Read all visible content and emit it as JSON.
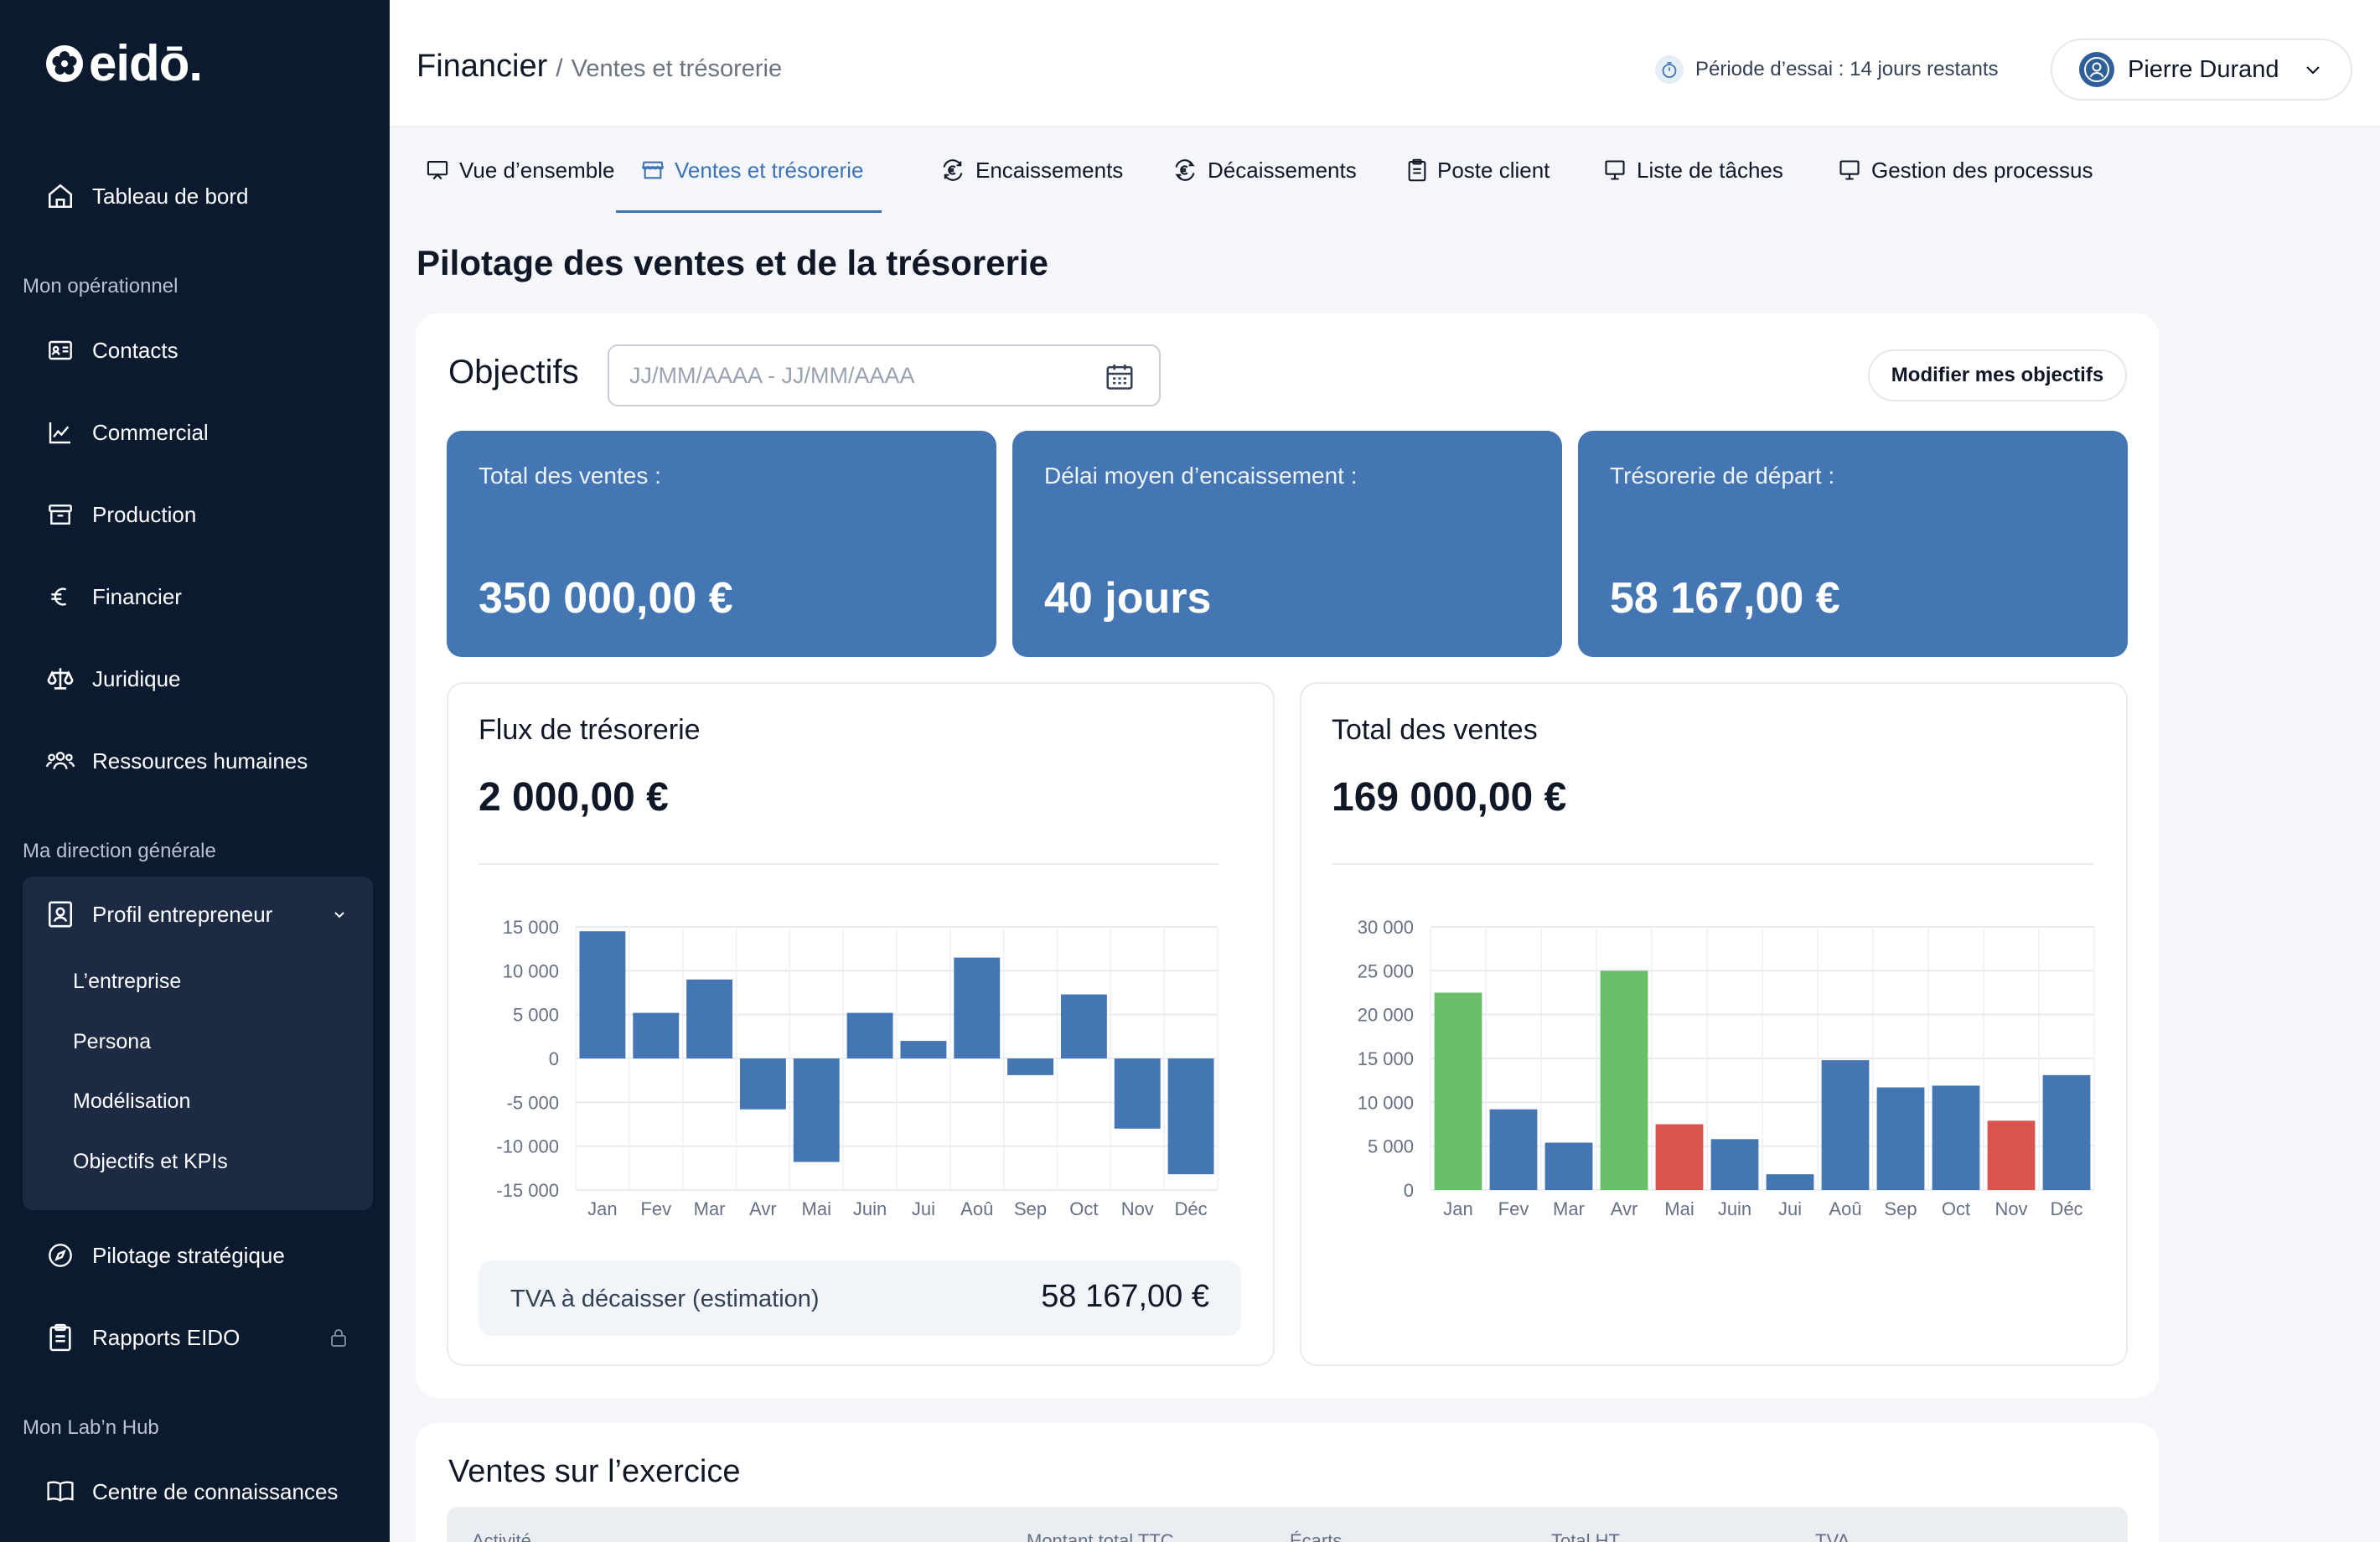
{
  "brand": {
    "name": "eidō."
  },
  "sidebar": {
    "home": {
      "label": "Tableau de bord",
      "icon": "home-icon"
    },
    "sections": [
      {
        "label": "Mon opérationnel"
      },
      {
        "label": "Ma direction générale"
      },
      {
        "label": "Mon Lab’n Hub"
      }
    ],
    "operational": [
      {
        "label": "Contacts",
        "icon": "contact-card-icon"
      },
      {
        "label": "Commercial",
        "icon": "line-chart-icon"
      },
      {
        "label": "Production",
        "icon": "archive-box-icon"
      },
      {
        "label": "Financier",
        "icon": "euro-icon"
      },
      {
        "label": "Juridique",
        "icon": "scale-icon"
      },
      {
        "label": "Ressources humaines",
        "icon": "users-icon"
      }
    ],
    "direction": {
      "label": "Profil entrepreneur",
      "icon": "profile-badge-icon",
      "children": [
        "L’entreprise",
        "Persona",
        "Modélisation",
        "Objectifs et KPIs"
      ]
    },
    "pilotage": {
      "label": "Pilotage stratégique",
      "icon": "compass-icon"
    },
    "rapports": {
      "label": "Rapports EIDO",
      "icon": "clipboard-icon",
      "locked": true
    },
    "hub": {
      "label": "Centre de connaissances",
      "icon": "book-icon"
    }
  },
  "header": {
    "title": "Financier",
    "separator": "/",
    "subtitle": "Ventes et trésorerie",
    "trial": "Période d’essai : 14 jours restants",
    "user": "Pierre Durand"
  },
  "tabs": [
    {
      "label": "Vue d’ensemble",
      "icon": "presentation-icon",
      "active": false
    },
    {
      "label": "Ventes et trésorerie",
      "icon": "store-icon",
      "active": true
    },
    {
      "label": "Encaissements",
      "icon": "euro-in-icon",
      "active": false
    },
    {
      "label": "Décaissements",
      "icon": "euro-out-icon",
      "active": false
    },
    {
      "label": "Poste client",
      "icon": "clipboard-icon",
      "active": false
    },
    {
      "label": "Liste de tâches",
      "icon": "board-icon",
      "active": false
    },
    {
      "label": "Gestion des processus",
      "icon": "board-icon",
      "active": false
    }
  ],
  "page": {
    "title": "Pilotage des ventes et de la trésorerie"
  },
  "objectives": {
    "title": "Objectifs",
    "date_placeholder": "JJ/MM/AAAA - JJ/MM/AAAA",
    "edit_button": "Modifier mes objectifs",
    "kpis": [
      {
        "label": "Total des ventes :",
        "value": "350 000,00 €"
      },
      {
        "label": "Délai moyen d’encaissement :",
        "value": "40 jours"
      },
      {
        "label": "Trésorerie de départ :",
        "value": "58 167,00 €"
      }
    ]
  },
  "cashflow": {
    "title": "Flux de trésorerie",
    "amount": "2 000,00 €",
    "tva_label": "TVA à décaisser (estimation)",
    "tva_value": "58 167,00 €"
  },
  "sales": {
    "title": "Total des ventes",
    "amount": "169 000,00 €"
  },
  "colors": {
    "blue": "#4376b3",
    "green": "#6abf69",
    "red": "#d9534f",
    "sidebar": "#0c1a30"
  },
  "chart_data": [
    {
      "type": "bar",
      "title": "Flux de trésorerie",
      "categories": [
        "Jan",
        "Fev",
        "Mar",
        "Avr",
        "Mai",
        "Juin",
        "Jui",
        "Aoû",
        "Sep",
        "Oct",
        "Nov",
        "Déc"
      ],
      "values": [
        14500,
        5200,
        9000,
        -5800,
        -11800,
        5200,
        2000,
        11500,
        -1900,
        7300,
        -8000,
        -13200
      ],
      "ylim": [
        -15000,
        15000
      ],
      "yticks": [
        15000,
        10000,
        5000,
        0,
        -5000,
        -10000,
        -15000
      ],
      "ytick_labels": [
        "15 000",
        "10 000",
        "5 000",
        "0",
        "-5 000",
        "-10 000",
        "-15 000"
      ],
      "grid": true
    },
    {
      "type": "bar",
      "title": "Total des ventes",
      "categories": [
        "Jan",
        "Fev",
        "Mar",
        "Avr",
        "Mai",
        "Juin",
        "Jui",
        "Aoû",
        "Sep",
        "Oct",
        "Nov",
        "Déc"
      ],
      "values": [
        22500,
        9200,
        5400,
        25000,
        7500,
        5800,
        1800,
        14800,
        11700,
        11900,
        7900,
        13100
      ],
      "bar_colors": [
        "#6abf69",
        "#4376b3",
        "#4376b3",
        "#6abf69",
        "#d9534f",
        "#4376b3",
        "#4376b3",
        "#4376b3",
        "#4376b3",
        "#4376b3",
        "#d9534f",
        "#4376b3"
      ],
      "ylim": [
        0,
        30000
      ],
      "yticks": [
        30000,
        25000,
        20000,
        15000,
        10000,
        5000,
        0
      ],
      "ytick_labels": [
        "30 000",
        "25 000",
        "20 000",
        "15 000",
        "10 000",
        "5 000",
        "0"
      ],
      "grid": true
    }
  ],
  "ventes": {
    "title": "Ventes sur l’exercice",
    "columns": [
      "Activité",
      "Montant total TTC",
      "Écarts",
      "Total HT",
      "TVA"
    ]
  }
}
